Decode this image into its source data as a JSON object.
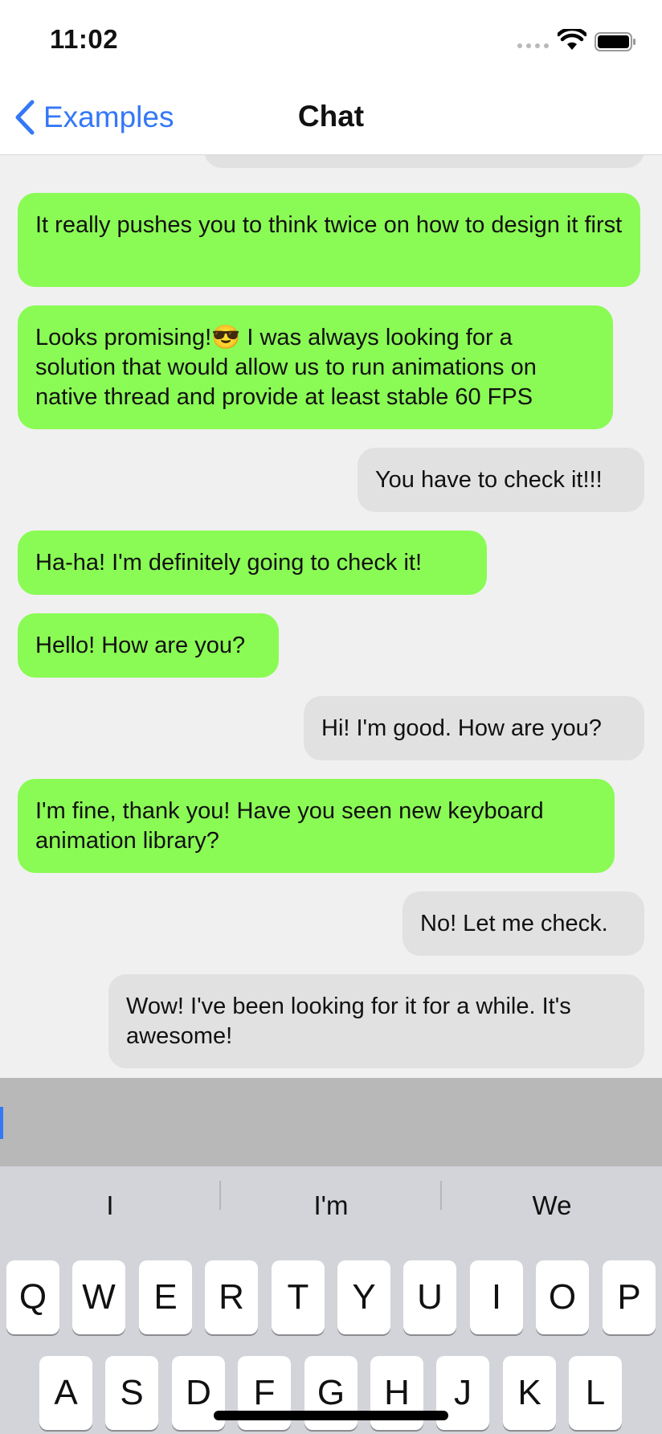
{
  "status_bar": {
    "time": "11:02"
  },
  "nav": {
    "back_label": "Examples",
    "title": "Chat"
  },
  "messages": [
    {
      "text": "",
      "sender": "other"
    },
    {
      "text": "It really pushes you to think twice on how to design it first",
      "sender": "me"
    },
    {
      "text": "Looks promising!😎 I was always looking for a solution that would allow us to run animations on native thread and provide at least stable 60 FPS",
      "sender": "me"
    },
    {
      "text": "You have to check it!!!",
      "sender": "other"
    },
    {
      "text": "Ha-ha! I'm definitely going to check it!",
      "sender": "me"
    },
    {
      "text": "Hello! How are you?",
      "sender": "me"
    },
    {
      "text": "Hi! I'm good. How are you?",
      "sender": "other"
    },
    {
      "text": "I'm fine, thank you! Have you seen new keyboard animation library?",
      "sender": "me"
    },
    {
      "text": "No! Let me check.",
      "sender": "other"
    },
    {
      "text": "Wow! I've been looking for it for a while. It's awesome!",
      "sender": "other"
    }
  ],
  "input": {
    "value": ""
  },
  "keyboard": {
    "suggestions": [
      "I",
      "I'm",
      "We"
    ],
    "row1": [
      "Q",
      "W",
      "E",
      "R",
      "T",
      "Y",
      "U",
      "I",
      "O",
      "P"
    ],
    "row2": [
      "A",
      "S",
      "D",
      "F",
      "G",
      "H",
      "J",
      "K",
      "L"
    ]
  },
  "colors": {
    "accent": "#3478f6",
    "my_bubble": "#8afb55",
    "other_bubble": "#e1e1e1",
    "background": "#f0f0f0",
    "keyboard_bg": "#d2d4d9"
  }
}
